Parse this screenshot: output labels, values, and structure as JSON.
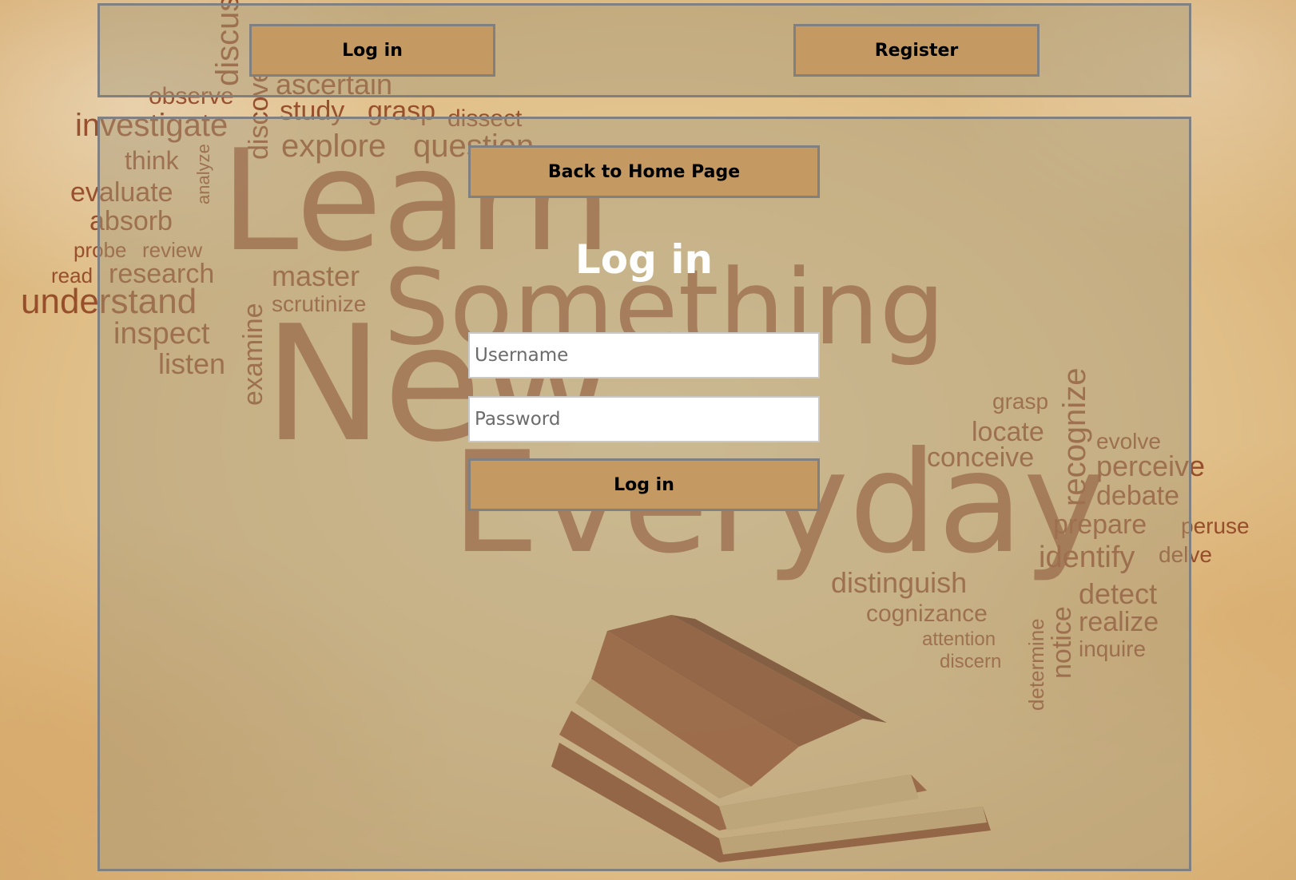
{
  "nav": {
    "login_label": "Log in",
    "register_label": "Register"
  },
  "main": {
    "home_label": "Back to Home Page",
    "title": "Log in",
    "username_placeholder": "Username",
    "password_placeholder": "Password",
    "submit_label": "Log in"
  },
  "artwork": {
    "headline": [
      "Learn",
      "Something",
      "New",
      "Everyday"
    ],
    "words_left": [
      "discuss",
      "observe",
      "ascertain",
      "investigate",
      "study",
      "grasp",
      "dissect",
      "discover",
      "explore",
      "question",
      "think",
      "analyze",
      "evaluate",
      "absorb",
      "probe",
      "review",
      "read",
      "research",
      "master",
      "understand",
      "scrutinize",
      "inspect",
      "examine",
      "listen"
    ],
    "words_right": [
      "grasp",
      "recognize",
      "locate",
      "evolve",
      "conceive",
      "perceive",
      "debate",
      "prepare",
      "peruse",
      "identify",
      "delve",
      "distinguish",
      "detect",
      "cognizance",
      "notice",
      "realize",
      "attention",
      "determine",
      "inquire",
      "discern"
    ]
  },
  "colors": {
    "button_bg": "#c49a62",
    "panel_border": "#808080",
    "word_color": "#8a3a1c",
    "title_color": "#ffffff"
  }
}
